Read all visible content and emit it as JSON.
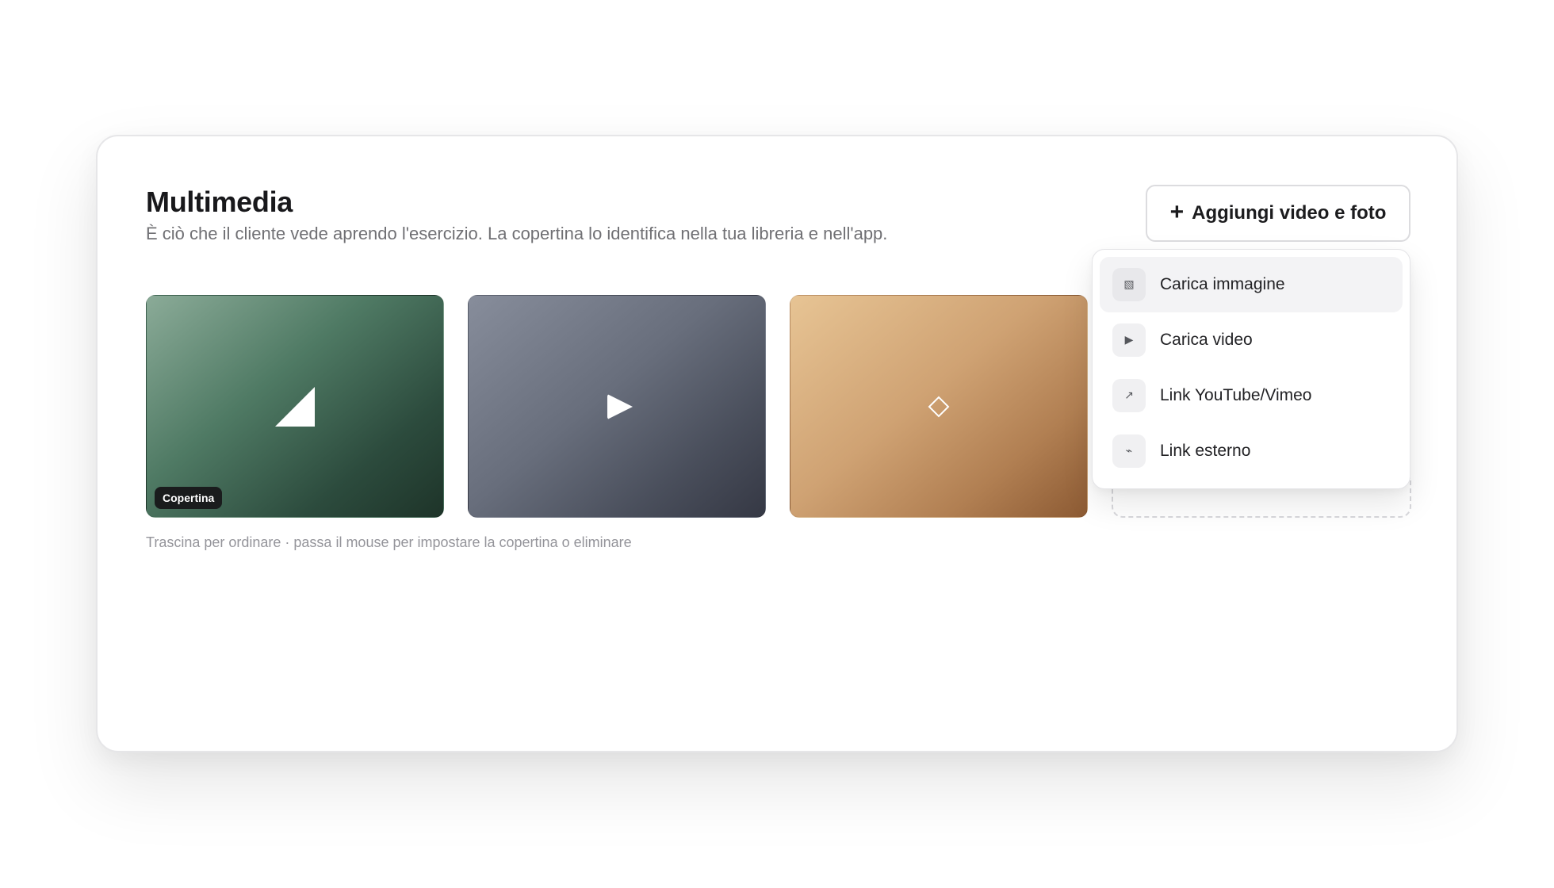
{
  "section": {
    "title": "Multimedia",
    "subtitle": "È ciò che il cliente vede aprendo l'esercizio. La copertina lo identifica nella tua libreria e nell'app.",
    "hint": "Trascina per ordinare · passa il mouse per impostare la copertina o eliminare"
  },
  "add_button": {
    "icon": "+",
    "label": "Aggiungi video e foto"
  },
  "media": [
    {
      "type": "image",
      "icon": "triangle-icon",
      "badge": "Copertina",
      "colors": [
        "#8bab98",
        "#1e3429"
      ]
    },
    {
      "type": "video",
      "icon": "play-icon",
      "colors": [
        "#878d9b",
        "#353844"
      ]
    },
    {
      "type": "link",
      "icon": "diamond-icon",
      "colors": [
        "#e7c494",
        "#8c5a33"
      ]
    }
  ],
  "menu": {
    "items": [
      {
        "icon": "image-icon",
        "glyph": "▧",
        "label": "Carica immagine",
        "active": true
      },
      {
        "icon": "play-icon",
        "glyph": "▶",
        "label": "Carica video"
      },
      {
        "icon": "arrow-up-right-icon",
        "glyph": "↗",
        "label": "Link YouTube/Vimeo"
      },
      {
        "icon": "link-icon",
        "glyph": "⌁",
        "label": "Link esterno"
      }
    ]
  }
}
